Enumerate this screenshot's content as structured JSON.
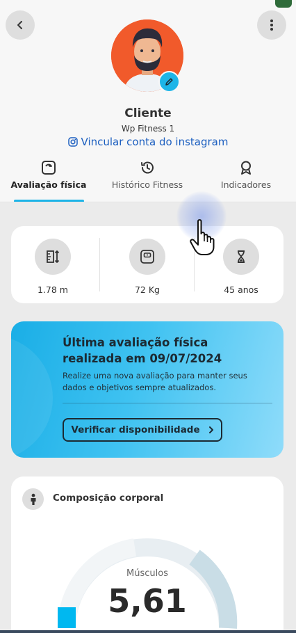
{
  "profile": {
    "name": "Cliente",
    "gym": "Wp Fitness 1",
    "instagram_link": "Vincular conta do instagram"
  },
  "tabs": [
    {
      "label": "Avaliação física",
      "icon": "scale-icon",
      "active": true
    },
    {
      "label": "Histórico Fitness",
      "icon": "history-icon",
      "active": false
    },
    {
      "label": "Indicadores",
      "icon": "award-icon",
      "active": false
    }
  ],
  "stats": [
    {
      "value": "1.78 m",
      "icon": "height-icon"
    },
    {
      "value": "72 Kg",
      "icon": "scale-icon"
    },
    {
      "value": "45 anos",
      "icon": "hourglass-icon"
    }
  ],
  "promo": {
    "title": "Última avaliação física realizada em  09/07/2024",
    "text": "Realize uma nova avaliação para manter seus dados e objetivos sempre atualizados.",
    "button": "Verificar disponibilidade"
  },
  "body_composition": {
    "title": "Composição corporal",
    "metric_label": "Músculos",
    "metric_value": "5,61"
  },
  "colors": {
    "accent": "#1db5e8",
    "link": "#1c5fc0",
    "avatar_bg": "#f15a2b"
  }
}
